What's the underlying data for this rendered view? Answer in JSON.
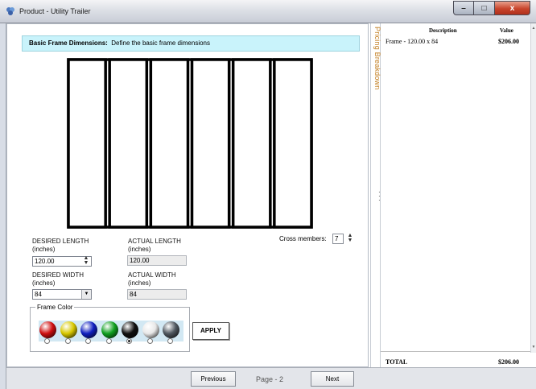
{
  "window": {
    "title": "Product - Utility Trailer",
    "minimize_glyph": "–",
    "maximize_glyph": "□",
    "close_glyph": "x"
  },
  "header": {
    "title": "Basic Frame Dimensions:",
    "description": "Define the basic frame dimensions"
  },
  "frame": {
    "segments": 6
  },
  "dimensions": {
    "desired_length_label": "DESIRED LENGTH",
    "desired_length_unit": "(inches)",
    "desired_length_value": "120.00",
    "actual_length_label": "ACTUAL LENGTH",
    "actual_length_unit": "(inches)",
    "actual_length_value": "120.00",
    "desired_width_label": "DESIRED WIDTH",
    "desired_width_unit": "(inches)",
    "desired_width_value": "84",
    "actual_width_label": "ACTUAL WIDTH",
    "actual_width_unit": "(inches)",
    "actual_width_value": "84"
  },
  "cross_members": {
    "label": "Cross members:",
    "value": "7"
  },
  "frame_color": {
    "label": "Frame Color",
    "selected_index": 4,
    "colors": [
      {
        "name": "red",
        "hex": "#d01010"
      },
      {
        "name": "yellow",
        "hex": "#d8c800"
      },
      {
        "name": "blue",
        "hex": "#1020c0"
      },
      {
        "name": "green",
        "hex": "#10a020"
      },
      {
        "name": "black",
        "hex": "#101010"
      },
      {
        "name": "white",
        "hex": "#e8e8e8"
      },
      {
        "name": "gray",
        "hex": "#505860"
      }
    ]
  },
  "apply_label": "APPLY",
  "side_tab": {
    "label": "Pricing Breakdown"
  },
  "pricing": {
    "col_description": "Description",
    "col_value": "Value",
    "items": [
      {
        "description": "Frame - 120.00 x 84",
        "value": "$206.00"
      }
    ],
    "total_label": "TOTAL",
    "total_value": "$206.00"
  },
  "nav": {
    "previous": "Previous",
    "page": "Page - 2",
    "next": "Next"
  },
  "icons": {
    "spinner_up": "▲",
    "spinner_down": "▼",
    "dropdown": "▼",
    "scroll_up": "▲",
    "scroll_down": "▼"
  }
}
